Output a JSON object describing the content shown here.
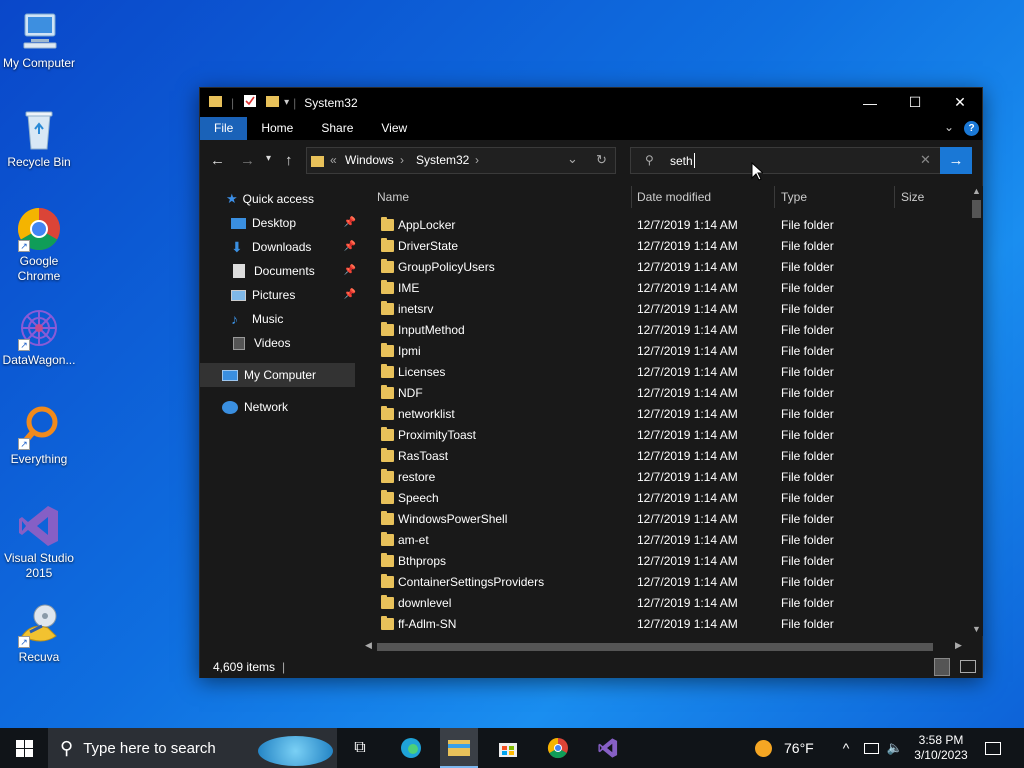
{
  "desktop": {
    "icons": [
      {
        "label": "My Computer",
        "icon": "computer-icon"
      },
      {
        "label": "Recycle Bin",
        "icon": "recycle-bin-icon"
      },
      {
        "label": "Google Chrome",
        "icon": "chrome-icon"
      },
      {
        "label": "DataWagon...",
        "icon": "datawagon-icon"
      },
      {
        "label": "Everything",
        "icon": "everything-search-icon"
      },
      {
        "label": "Visual Studio 2015",
        "icon": "visual-studio-icon"
      },
      {
        "label": "Recuva",
        "icon": "recuva-icon"
      }
    ]
  },
  "window": {
    "title": "System32",
    "controls": {
      "minimize": "—",
      "maximize": "☐",
      "close": "✕"
    },
    "ribbon_tabs": [
      "File",
      "Home",
      "Share",
      "View"
    ],
    "address": {
      "overflow": "«",
      "crumbs": [
        "Windows",
        "System32"
      ]
    },
    "search": {
      "value": "seth"
    },
    "nav": {
      "quick_access": "Quick access",
      "pinned": [
        "Desktop",
        "Downloads",
        "Documents",
        "Pictures"
      ],
      "unpinned": [
        "Music",
        "Videos"
      ],
      "my_computer": "My Computer",
      "network": "Network"
    },
    "columns": {
      "name": "Name",
      "date": "Date modified",
      "type": "Type",
      "size": "Size"
    },
    "files": [
      {
        "name": "AppLocker",
        "date": "12/7/2019 1:14 AM",
        "type": "File folder"
      },
      {
        "name": "DriverState",
        "date": "12/7/2019 1:14 AM",
        "type": "File folder"
      },
      {
        "name": "GroupPolicyUsers",
        "date": "12/7/2019 1:14 AM",
        "type": "File folder"
      },
      {
        "name": "IME",
        "date": "12/7/2019 1:14 AM",
        "type": "File folder"
      },
      {
        "name": "inetsrv",
        "date": "12/7/2019 1:14 AM",
        "type": "File folder"
      },
      {
        "name": "InputMethod",
        "date": "12/7/2019 1:14 AM",
        "type": "File folder"
      },
      {
        "name": "Ipmi",
        "date": "12/7/2019 1:14 AM",
        "type": "File folder"
      },
      {
        "name": "Licenses",
        "date": "12/7/2019 1:14 AM",
        "type": "File folder"
      },
      {
        "name": "NDF",
        "date": "12/7/2019 1:14 AM",
        "type": "File folder"
      },
      {
        "name": "networklist",
        "date": "12/7/2019 1:14 AM",
        "type": "File folder"
      },
      {
        "name": "ProximityToast",
        "date": "12/7/2019 1:14 AM",
        "type": "File folder"
      },
      {
        "name": "RasToast",
        "date": "12/7/2019 1:14 AM",
        "type": "File folder"
      },
      {
        "name": "restore",
        "date": "12/7/2019 1:14 AM",
        "type": "File folder"
      },
      {
        "name": "Speech",
        "date": "12/7/2019 1:14 AM",
        "type": "File folder"
      },
      {
        "name": "WindowsPowerShell",
        "date": "12/7/2019 1:14 AM",
        "type": "File folder"
      },
      {
        "name": "am-et",
        "date": "12/7/2019 1:14 AM",
        "type": "File folder"
      },
      {
        "name": "Bthprops",
        "date": "12/7/2019 1:14 AM",
        "type": "File folder"
      },
      {
        "name": "ContainerSettingsProviders",
        "date": "12/7/2019 1:14 AM",
        "type": "File folder"
      },
      {
        "name": "downlevel",
        "date": "12/7/2019 1:14 AM",
        "type": "File folder"
      },
      {
        "name": "ff-Adlm-SN",
        "date": "12/7/2019 1:14 AM",
        "type": "File folder"
      }
    ],
    "status": {
      "item_count": "4,609 items"
    }
  },
  "taskbar": {
    "search_placeholder": "Type here to search",
    "weather": "76°F",
    "time": "3:58 PM",
    "date": "3/10/2023"
  },
  "colors": {
    "accent": "#1a62b8",
    "search_go": "#1a78d6",
    "folder": "#e8c15a"
  }
}
